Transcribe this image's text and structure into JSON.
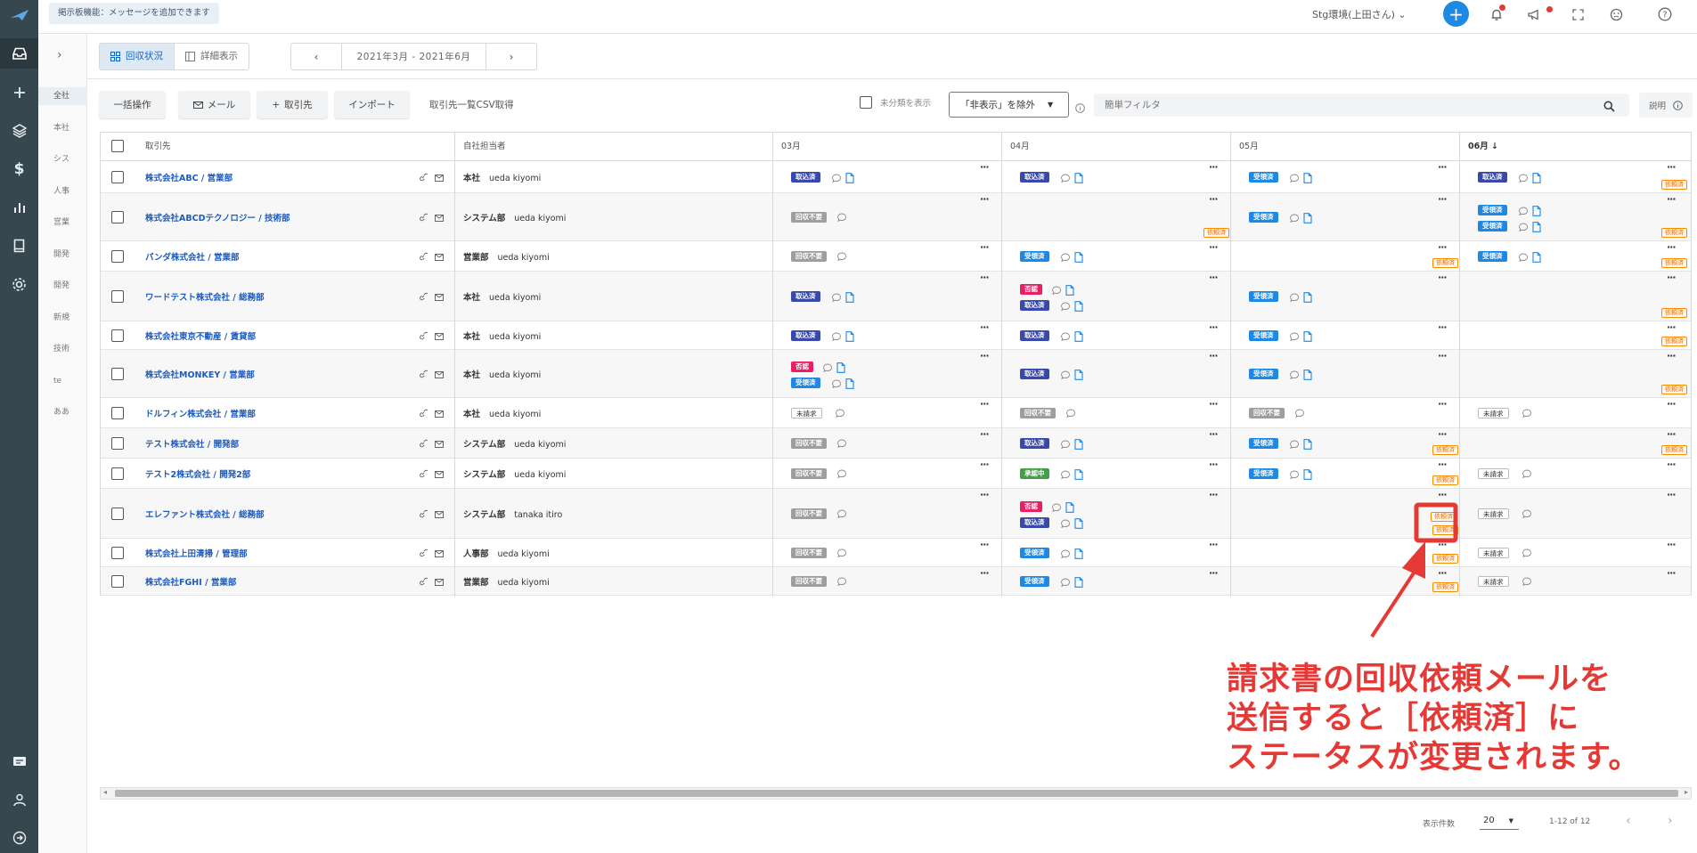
{
  "colors": {
    "accent": "#1e88e5",
    "rail": "#37474f",
    "annotation": "#e53935"
  },
  "header": {
    "notice": "掲示板機能：メッセージを追加できます",
    "env": "Stg環境(上田さん)"
  },
  "toolbar": {
    "view_tabs": [
      "回収状況",
      "詳細表示"
    ],
    "range": "2021年3月 - 2021年6月",
    "bulk": "一括操作",
    "mail": "メール",
    "add_client": "取引先",
    "import": "インポート",
    "csv": "取引先一覧CSV取得",
    "unclassified": "未分類を表示",
    "hide_select": "「非表示」を除外",
    "filter_placeholder": "簡単フィルタ",
    "help": "説明"
  },
  "subnav": [
    "全社",
    "本社",
    "シス",
    "人事",
    "営業",
    "開発",
    "開発",
    "新規",
    "技術",
    "te",
    "ああ"
  ],
  "table": {
    "columns": [
      "取引先",
      "自社担当者",
      "03月",
      "04月",
      "05月",
      "06月"
    ],
    "rows": [
      {
        "name": "株式会社ABC / 営業部",
        "dept": "本社",
        "person": "ueda kiyomi"
      },
      {
        "name": "株式会社ABCDテクノロジー / 技術部",
        "dept": "システム部",
        "person": "ueda kiyomi"
      },
      {
        "name": "パンダ株式会社 / 営業部",
        "dept": "営業部",
        "person": "ueda kiyomi"
      },
      {
        "name": "ワードテスト株式会社 / 総務部",
        "dept": "本社",
        "person": "ueda kiyomi"
      },
      {
        "name": "株式会社東京不動産 / 賃貸部",
        "dept": "本社",
        "person": "ueda kiyomi"
      },
      {
        "name": "株式会社MONKEY / 営業部",
        "dept": "本社",
        "person": "ueda kiyomi"
      },
      {
        "name": "ドルフィン株式会社 / 営業部",
        "dept": "本社",
        "person": "ueda kiyomi"
      },
      {
        "name": "テスト株式会社 / 開発部",
        "dept": "システム部",
        "person": "ueda kiyomi"
      },
      {
        "name": "テスト2株式会社 / 開発2部",
        "dept": "システム部",
        "person": "ueda kiyomi"
      },
      {
        "name": "エレファント株式会社 / 総務部",
        "dept": "システム部",
        "person": "tanaka itiro"
      },
      {
        "name": "株式会社上田清掃 / 管理部",
        "dept": "人事部",
        "person": "ueda kiyomi"
      },
      {
        "name": "株式会社FGHI / 営業部",
        "dept": "営業部",
        "person": "ueda kiyomi"
      }
    ],
    "status_labels": {
      "tori": "取込済",
      "juryo": "受領済",
      "kai": "回収不要",
      "hi": "否認",
      "sho": "承認中",
      "mi": "未請求",
      "irai": "依頼済"
    }
  },
  "pagination": {
    "label": "表示件数",
    "size": "20",
    "range": "1-12 of 12"
  },
  "annotation": {
    "line1": "請求書の回収依頼メールを",
    "line2": "送信すると［依頼済］に",
    "line3": "ステータスが変更されます。"
  }
}
